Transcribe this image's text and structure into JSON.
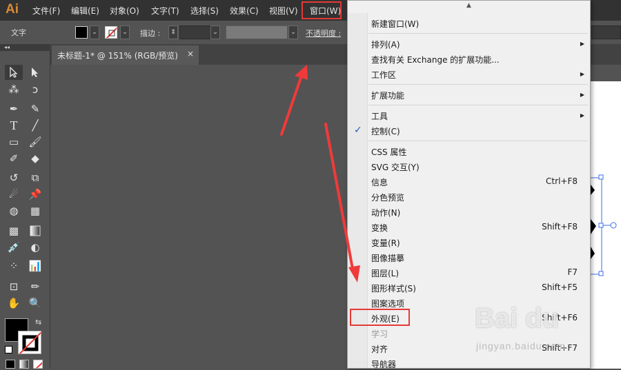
{
  "app": {
    "logo": "Ai"
  },
  "menubar": {
    "items": [
      "文件(F)",
      "编辑(E)",
      "对象(O)",
      "文字(T)",
      "选择(S)",
      "效果(C)",
      "视图(V)",
      "窗口(W)"
    ]
  },
  "control_bar": {
    "mode_label": "文字",
    "stroke_label": "描边 :",
    "opacity_label": "不透明度 :"
  },
  "panel_grip": "◂◂",
  "document_tab": {
    "title": "未标题-1* @ 151% (RGB/预览)",
    "close": "×"
  },
  "window_menu": {
    "items": [
      {
        "label": "新建窗口(W)"
      },
      {
        "label": "排列(A)",
        "submenu": true
      },
      {
        "label": "查找有关 Exchange 的扩展功能..."
      },
      {
        "label": "工作区",
        "submenu": true
      },
      {
        "label": "扩展功能",
        "submenu": true
      },
      {
        "label": "工具",
        "submenu": true
      },
      {
        "label": "控制(C)",
        "checked": true
      },
      {
        "label": "CSS 属性"
      },
      {
        "label": "SVG 交互(Y)"
      },
      {
        "label": "信息",
        "shortcut": "Ctrl+F8"
      },
      {
        "label": "分色预览"
      },
      {
        "label": "动作(N)"
      },
      {
        "label": "变换",
        "shortcut": "Shift+F8"
      },
      {
        "label": "变量(R)"
      },
      {
        "label": "图像描摹"
      },
      {
        "label": "图层(L)",
        "shortcut": "F7"
      },
      {
        "label": "图形样式(S)",
        "shortcut": "Shift+F5"
      },
      {
        "label": "图案选项"
      },
      {
        "label": "外观(E)",
        "shortcut": "Shift+F6"
      },
      {
        "label": "学习",
        "disabled": true
      },
      {
        "label": "对齐",
        "shortcut": "Shift+F7"
      },
      {
        "label": "导航器"
      }
    ],
    "checkmark": "✓",
    "submenu_glyph": "▶",
    "scroll_glyph": "▲"
  },
  "watermark": {
    "brand": "Bai du",
    "url": "jingyan.baidu.com"
  },
  "colors": {
    "highlight": "#e53935",
    "menu_bg": "#f0f0f0",
    "app_bg": "#535353",
    "logo": "#d98a35"
  }
}
